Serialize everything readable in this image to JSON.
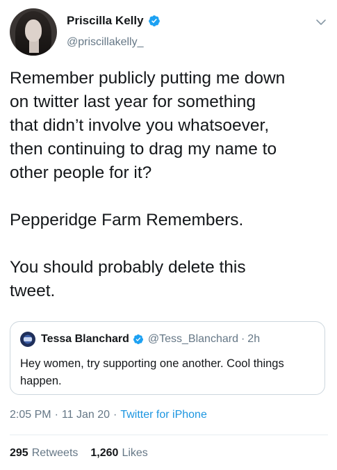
{
  "author": {
    "name": "Priscilla Kelly",
    "handle": "@priscillakelly_"
  },
  "tweet": {
    "text": "Remember publicly putting me down\non twitter last year for something\nthat didn’t involve you whatsoever,\nthen continuing to drag my name to\nother people for it?\n\nPepperidge Farm Remembers.\n\nYou should probably delete this\ntweet."
  },
  "quoted_tweet": {
    "name": "Tessa Blanchard",
    "handle": "@Tess_Blanchard",
    "separator": "·",
    "time": "2h",
    "text": "Hey women, try supporting one another. Cool things happen."
  },
  "meta": {
    "time": "2:05 PM",
    "date": "11 Jan 20",
    "source": "Twitter for iPhone",
    "separator": "·"
  },
  "stats": {
    "retweets_count": "295",
    "retweets_label": "Retweets",
    "likes_count": "1,260",
    "likes_label": "Likes"
  },
  "colors": {
    "verified": "#1da1f2",
    "link": "#1b95e0",
    "secondary_text": "#657786"
  },
  "icons": {
    "verified": "verified-badge-icon",
    "menu": "chevron-down-icon"
  }
}
